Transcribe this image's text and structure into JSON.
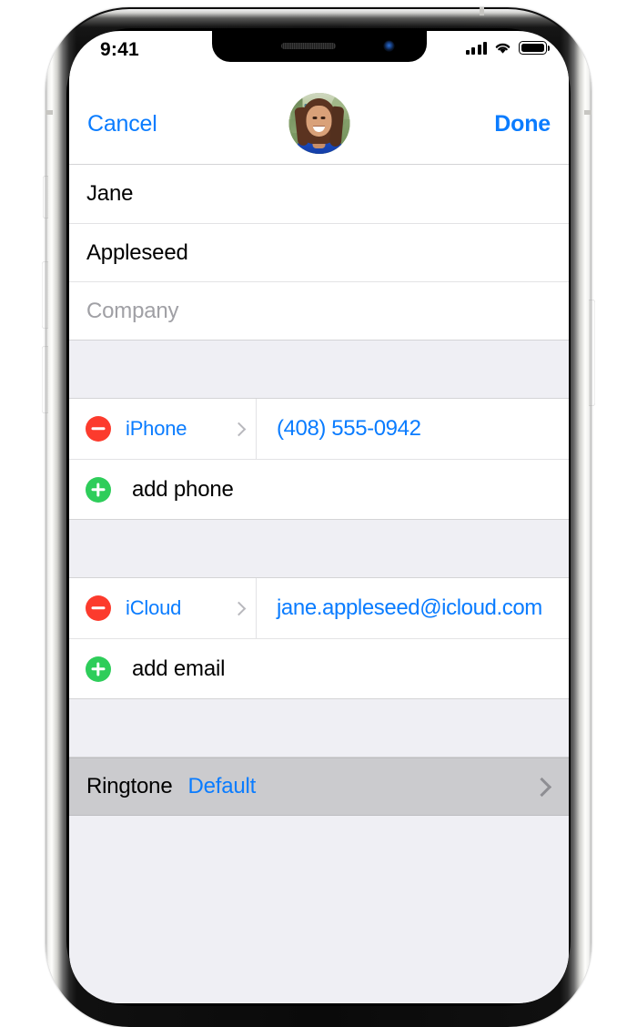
{
  "device": {
    "name": "iphone-x",
    "statusbar": {
      "time": "9:41",
      "cellular_icon": "cellular-signal-icon",
      "wifi_icon": "wifi-icon",
      "battery_icon": "battery-icon"
    }
  },
  "navbar": {
    "cancel_label": "Cancel",
    "done_label": "Done",
    "avatar_name": "contact-photo"
  },
  "contact": {
    "first_name": "Jane",
    "last_name": "Appleseed",
    "company_placeholder": "Company"
  },
  "phones": {
    "entries": [
      {
        "label": "iPhone",
        "value": "(408) 555-0942",
        "remove_icon": "minus-circle-icon",
        "chevron_icon": "chevron-right-icon"
      }
    ],
    "add_label": "add phone",
    "add_icon": "plus-circle-icon"
  },
  "emails": {
    "entries": [
      {
        "label": "iCloud",
        "value": "jane.appleseed@icloud.com",
        "remove_icon": "minus-circle-icon",
        "chevron_icon": "chevron-right-icon"
      }
    ],
    "add_label": "add email",
    "add_icon": "plus-circle-icon"
  },
  "ringtone": {
    "label": "Ringtone",
    "value": "Default",
    "chevron_icon": "chevron-right-icon"
  },
  "colors": {
    "accent_blue": "#0a7cff",
    "remove_red": "#fc3b2d",
    "add_green": "#2ecd5a",
    "group_background": "#efeff4",
    "row_background": "#ffffff",
    "selected_row": "#cbcbce",
    "placeholder_gray": "#a0a0a5",
    "separator": "#e3e3e5"
  }
}
